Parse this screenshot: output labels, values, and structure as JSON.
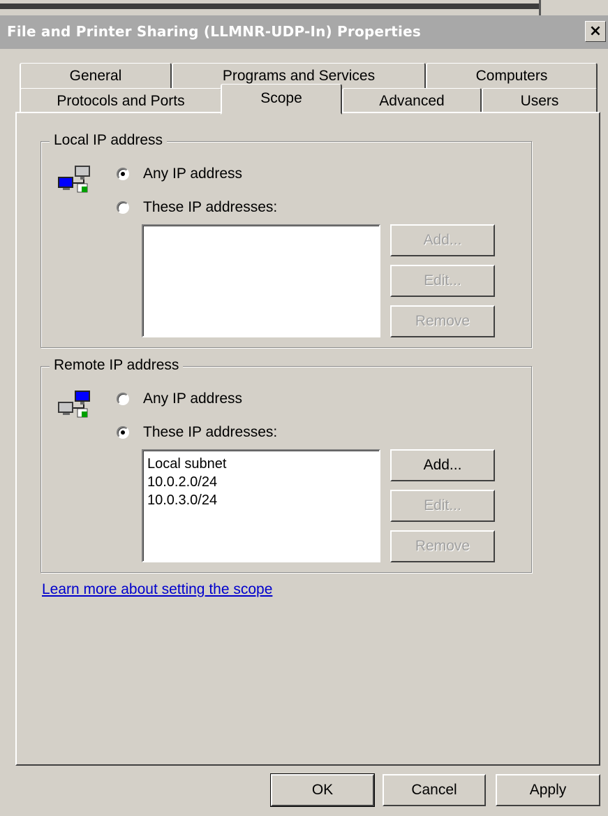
{
  "window": {
    "title": "File and Printer Sharing (LLMNR-UDP-In) Properties",
    "close_glyph": "×"
  },
  "tabs": {
    "row1": [
      {
        "label": "General"
      },
      {
        "label": "Programs and Services"
      },
      {
        "label": "Computers"
      }
    ],
    "row2": [
      {
        "label": "Protocols and Ports"
      },
      {
        "label": "Scope",
        "selected": true
      },
      {
        "label": "Advanced"
      },
      {
        "label": "Users"
      }
    ]
  },
  "local": {
    "legend": "Local IP address",
    "icon": "network-computers-icon",
    "options": [
      {
        "label": "Any IP address",
        "checked": true
      },
      {
        "label": "These IP addresses:",
        "checked": false
      }
    ],
    "addresses": [],
    "buttons": {
      "add": "Add...",
      "edit": "Edit...",
      "remove": "Remove"
    },
    "buttons_enabled": {
      "add": false,
      "edit": false,
      "remove": false
    }
  },
  "remote": {
    "legend": "Remote IP address",
    "icon": "network-computers-icon",
    "options": [
      {
        "label": "Any IP address",
        "checked": false
      },
      {
        "label": "These IP addresses:",
        "checked": true
      }
    ],
    "addresses": [
      "Local subnet",
      "10.0.2.0/24",
      "10.0.3.0/24"
    ],
    "buttons": {
      "add": "Add...",
      "edit": "Edit...",
      "remove": "Remove"
    },
    "buttons_enabled": {
      "add": true,
      "edit": false,
      "remove": false
    }
  },
  "help_link": "Learn more about setting the scope",
  "footer": {
    "ok": "OK",
    "cancel": "Cancel",
    "apply": "Apply"
  },
  "colors": {
    "face": "#d4d0c8",
    "titlebar_inactive": "#a8a8a8",
    "link": "#0000cc",
    "disabled_text": "#a0a0a0"
  }
}
